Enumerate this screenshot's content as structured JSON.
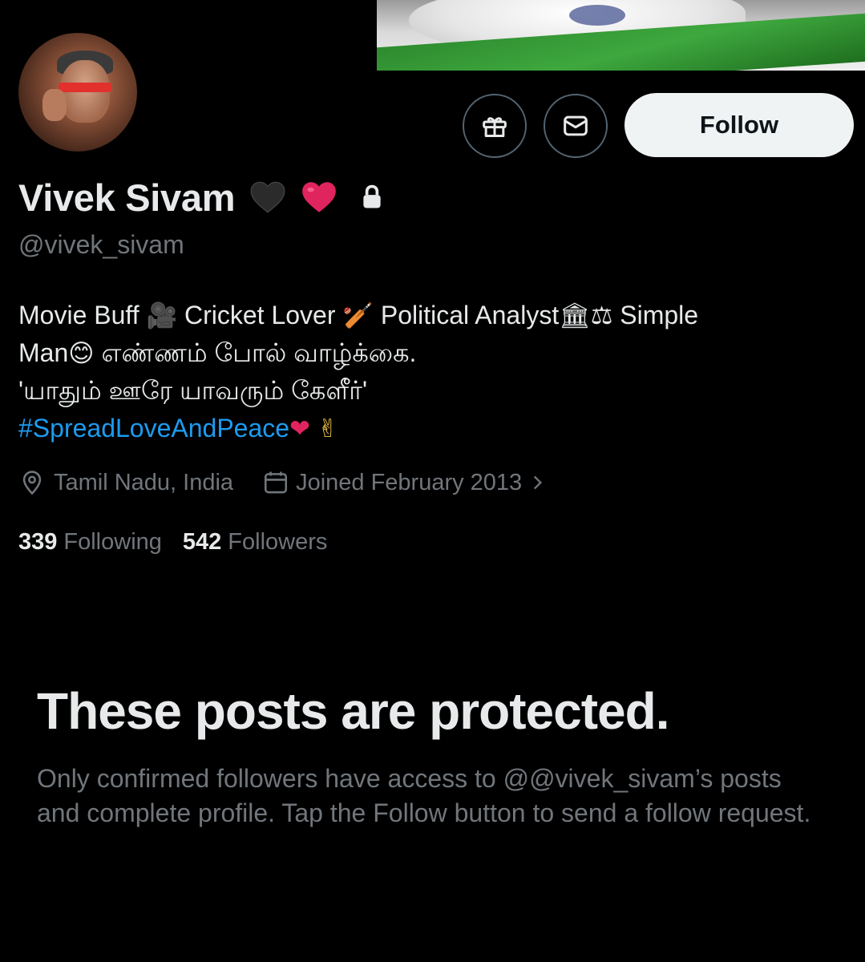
{
  "profile": {
    "name": "Vivek Sivam",
    "handle": "@vivek_sivam",
    "bio_line1_a": "Movie Buff ",
    "bio_line1_emoji_camera": "🎥",
    "bio_line1_b": " Cricket Lover ",
    "bio_line1_emoji_cricket": "🏏",
    "bio_line1_c": " Political Analyst",
    "bio_line1_emoji_bank": "🏛",
    "bio_line1_emoji_scales": "⚖",
    "bio_line1_d": " Simple",
    "bio_line2_a": "Man",
    "bio_line2_emoji_smile": "😊",
    "bio_line2_b": " எண்ணம் போல் வாழ்க்கை.",
    "bio_line3": " 'யாதும் ஊரே யாவரும் கேளீர்'",
    "hashtag": "#SpreadLoveAndPeace",
    "hashtag_emoji_heart": "❤",
    "hashtag_emoji_victory": "✌",
    "location": "Tamil Nadu, India",
    "joined": "Joined February 2013",
    "following_count": "339",
    "following_label": "Following",
    "followers_count": "542",
    "followers_label": "Followers"
  },
  "actions": {
    "follow_label": "Follow",
    "gift_icon": "gift-icon",
    "message_icon": "mail-icon"
  },
  "protected": {
    "title": "These posts are protected.",
    "body": "Only confirmed followers have access to @@vivek_sivam’s posts and complete profile. Tap the Follow button to send a follow request."
  },
  "colors": {
    "background": "#000000",
    "text_primary": "#e7e9ea",
    "text_secondary": "#71767b",
    "link": "#1d9bf0",
    "follow_bg": "#eff3f4",
    "border": "#536471",
    "heart_red": "#e0245e",
    "heart_black": "#2b2b2b"
  }
}
